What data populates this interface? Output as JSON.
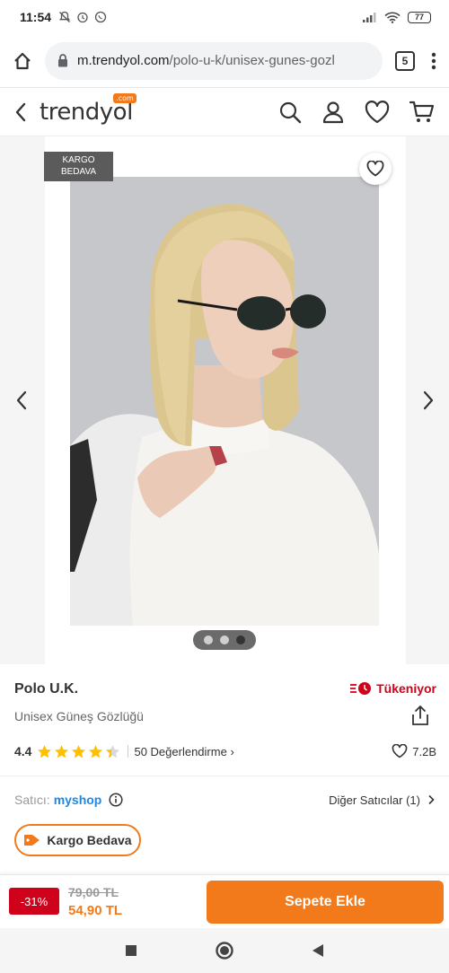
{
  "status_bar": {
    "time": "11:54",
    "battery": "77"
  },
  "browser": {
    "url_domain": "m.trendyol.com",
    "url_path": "/polo-u-k/unisex-gunes-gozl",
    "tab_count": "5"
  },
  "site": {
    "logo": "trendyol",
    "logo_badge": ".com"
  },
  "gallery": {
    "badge_line1": "KARGO",
    "badge_line2": "BEDAVA",
    "image_count": 3,
    "active_index": 2
  },
  "product": {
    "brand": "Polo U.K.",
    "name": "Unisex Güneş Gözlüğü",
    "stock_status": "Tükeniyor",
    "rating": "4.4",
    "rating_value": 4.4,
    "reviews_label": "50 Değerlendirme",
    "likes": "7.2B"
  },
  "seller": {
    "label": "Satıcı:",
    "name": "myshop",
    "other_sellers": "Diğer Satıcılar (1)"
  },
  "shipping_pill": "Kargo Bedava",
  "pricing": {
    "discount": "-31%",
    "old_price": "79,00 TL",
    "new_price": "54,90 TL",
    "cta": "Sepete Ekle"
  },
  "colors": {
    "brand_orange": "#f27a1a",
    "discount_red": "#d0021b",
    "seller_blue": "#1e88e5"
  }
}
